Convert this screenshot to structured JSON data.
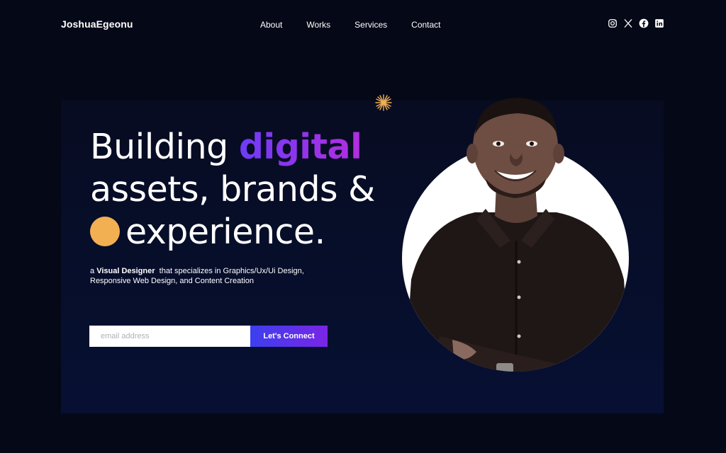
{
  "brand": {
    "name": "JoshuaEgeonu"
  },
  "nav": {
    "items": [
      "About",
      "Works",
      "Services",
      "Contact"
    ]
  },
  "socials": [
    "instagram-icon",
    "x-icon",
    "facebook-icon",
    "linkedin-icon"
  ],
  "hero": {
    "line1_prefix": "Building",
    "line1_highlight": "digital",
    "line2": "assets, brands &",
    "line3": "experience.",
    "sub_prefix": "a",
    "sub_bold": "Visual Designer",
    "sub_rest1": "that specializes in Graphics/Ux/Ui Design,",
    "sub_rest2": "Responsive Web Design, and Content Creation"
  },
  "form": {
    "placeholder": "email address",
    "button_label": "Let's Connect"
  },
  "colors": {
    "background": "#050817",
    "accent_purple": "#7a25e6",
    "accent_blue": "#3c3fee",
    "accent_orange": "#f2b053"
  }
}
